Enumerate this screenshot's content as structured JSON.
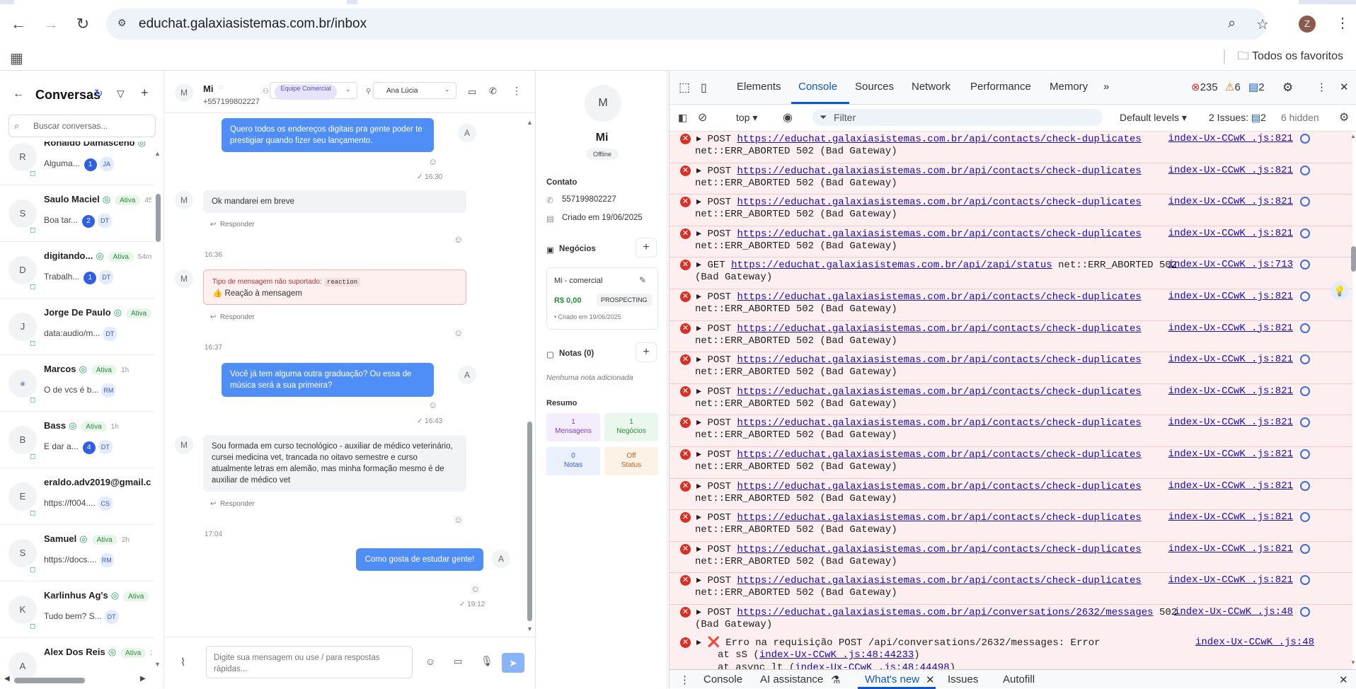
{
  "browser": {
    "url": "educhat.galaxiasistemas.com.br/inbox",
    "profile_initial": "Z",
    "bookmarks_label": "Todos os favoritos"
  },
  "sidebar": {
    "title": "Conversas",
    "search_placeholder": "Buscar conversas...",
    "conversations": [
      {
        "initial": "R",
        "name": "Ronaldo Damasceno",
        "status": "",
        "time": "",
        "preview": "Alguma...",
        "count": "1",
        "agent": "JA"
      },
      {
        "initial": "S",
        "name": "Saulo Maciel",
        "status": "Ativa",
        "time": "45",
        "preview": "Boa tar...",
        "count": "2",
        "agent": "DT"
      },
      {
        "initial": "D",
        "name": "digitando...",
        "status": "Ativa",
        "time": "54m",
        "preview": "Trabalh...",
        "count": "1",
        "agent": "DT"
      },
      {
        "initial": "J",
        "name": "Jorge De Paulo",
        "status": "Ativa",
        "time": "",
        "preview": "data:audio/m...",
        "count": "",
        "agent": "DT"
      },
      {
        "initial": "",
        "name": "Marcos",
        "status": "Ativa",
        "time": "1h",
        "preview": "O de vcs é b...",
        "count": "",
        "agent": "RM"
      },
      {
        "initial": "B",
        "name": "Bass",
        "status": "Ativa",
        "time": "1h",
        "preview": "E dar a...",
        "count": "4",
        "agent": "DT"
      },
      {
        "initial": "E",
        "name": "eraldo.adv2019@gmail.com",
        "status": "",
        "time": "",
        "preview": "https://f004....",
        "count": "",
        "agent": "CS"
      },
      {
        "initial": "S",
        "name": "Samuel",
        "status": "Ativa",
        "time": "2h",
        "preview": "https://docs....",
        "count": "",
        "agent": "RM"
      },
      {
        "initial": "K",
        "name": "Karlinhus Ag's",
        "status": "Ativa",
        "time": "2",
        "preview": "Tudo bem? S...",
        "count": "",
        "agent": "DT"
      },
      {
        "initial": "A",
        "name": "Alex Dos Reis",
        "status": "Ativa",
        "time": "2h",
        "preview": "",
        "count": "",
        "agent": ""
      }
    ]
  },
  "chat": {
    "contact_initial": "M",
    "contact_name": "Mi",
    "contact_phone": "+557199802227",
    "team": "Equipe Comercial",
    "agent": "Ana Lúcia",
    "messages": {
      "m1": "Quero todos os endereços digitais pra gente poder te prestigiar quando fizer seu lançamento.",
      "m1_time": "16:30",
      "m2": "Ok mandarei em breve",
      "reply": "Responder",
      "t1636": "16:36",
      "unsupported_label": "Tipo de mensagem não suportado:",
      "unsupported_type": "reaction",
      "reaction_text": "👍 Reação à mensagem",
      "t1637": "16:37",
      "m3": "Você já tem alguma outra graduação? Ou essa de música será a sua primeira?",
      "m3_time": "16:43",
      "m4": "Sou formada em curso tecnológico - auxiliar de médico veterinário, cursei medicina vet, trancada no oitavo semestre e curso atualmente letras em alemão, mas minha formação mesmo é de auxiliar de médico vet",
      "t1704": "17:04",
      "m5": "Como gosta de estudar gente!",
      "m5_time": "19:12",
      "out_avatar": "A"
    },
    "composer_placeholder": "Digite sua mensagem ou use / para respostas rápidas..."
  },
  "contact": {
    "initial": "M",
    "name": "Mi",
    "status": "Offline",
    "section_contact": "Contato",
    "phone": "557199802227",
    "created": "Criado em 19/06/2025",
    "deals_title": "Negócios",
    "deal_name": "Mi - comercial",
    "deal_value": "R$ 0,00",
    "deal_stage": "PROSPECTING",
    "deal_created": "• Criado em 19/06/2025",
    "notes_title": "Notas (0)",
    "notes_empty": "Nenhuma nota adicionada",
    "summary_title": "Resumo",
    "stats": [
      {
        "value": "1",
        "label": "Mensagens"
      },
      {
        "value": "1",
        "label": "Negócios"
      },
      {
        "value": "0",
        "label": "Notas"
      },
      {
        "value": "Off",
        "label": "Status"
      }
    ]
  },
  "devtools": {
    "tabs": [
      "Elements",
      "Console",
      "Sources",
      "Network",
      "Performance",
      "Memory"
    ],
    "errors": "235",
    "warnings": "6",
    "infos": "2",
    "context": "top",
    "filter_placeholder": "Filter",
    "levels": "Default levels",
    "issues": "2 Issues:",
    "issues_count": "2",
    "hidden": "6 hidden",
    "logs": [
      {
        "method": "POST",
        "url": "https://educhat.galaxiasistemas.com.br/api/contacts/check-duplicates",
        "tail": "",
        "line2": "net::ERR_ABORTED 502 (Bad Gateway)",
        "src": "index-Ux-CCwK_.js:821"
      },
      {
        "method": "POST",
        "url": "https://educhat.galaxiasistemas.com.br/api/contacts/check-duplicates",
        "tail": "",
        "line2": "net::ERR_ABORTED 502 (Bad Gateway)",
        "src": "index-Ux-CCwK_.js:821"
      },
      {
        "method": "POST",
        "url": "https://educhat.galaxiasistemas.com.br/api/contacts/check-duplicates",
        "tail": "",
        "line2": "net::ERR_ABORTED 502 (Bad Gateway)",
        "src": "index-Ux-CCwK_.js:821"
      },
      {
        "method": "POST",
        "url": "https://educhat.galaxiasistemas.com.br/api/contacts/check-duplicates",
        "tail": "",
        "line2": "net::ERR_ABORTED 502 (Bad Gateway)",
        "src": "index-Ux-CCwK_.js:821"
      },
      {
        "method": "GET",
        "url": "https://educhat.galaxiasistemas.com.br/api/zapi/status",
        "tail": " net::ERR_ABORTED 502",
        "line2": "(Bad Gateway)",
        "src": "index-Ux-CCwK_.js:713"
      },
      {
        "method": "POST",
        "url": "https://educhat.galaxiasistemas.com.br/api/contacts/check-duplicates",
        "tail": "",
        "line2": "net::ERR_ABORTED 502 (Bad Gateway)",
        "src": "index-Ux-CCwK_.js:821"
      },
      {
        "method": "POST",
        "url": "https://educhat.galaxiasistemas.com.br/api/contacts/check-duplicates",
        "tail": "",
        "line2": "net::ERR_ABORTED 502 (Bad Gateway)",
        "src": "index-Ux-CCwK_.js:821"
      },
      {
        "method": "POST",
        "url": "https://educhat.galaxiasistemas.com.br/api/contacts/check-duplicates",
        "tail": "",
        "line2": "net::ERR_ABORTED 502 (Bad Gateway)",
        "src": "index-Ux-CCwK_.js:821"
      },
      {
        "method": "POST",
        "url": "https://educhat.galaxiasistemas.com.br/api/contacts/check-duplicates",
        "tail": "",
        "line2": "net::ERR_ABORTED 502 (Bad Gateway)",
        "src": "index-Ux-CCwK_.js:821"
      },
      {
        "method": "POST",
        "url": "https://educhat.galaxiasistemas.com.br/api/contacts/check-duplicates",
        "tail": "",
        "line2": "net::ERR_ABORTED 502 (Bad Gateway)",
        "src": "index-Ux-CCwK_.js:821"
      },
      {
        "method": "POST",
        "url": "https://educhat.galaxiasistemas.com.br/api/contacts/check-duplicates",
        "tail": "",
        "line2": "net::ERR_ABORTED 502 (Bad Gateway)",
        "src": "index-Ux-CCwK_.js:821"
      },
      {
        "method": "POST",
        "url": "https://educhat.galaxiasistemas.com.br/api/contacts/check-duplicates",
        "tail": "",
        "line2": "net::ERR_ABORTED 502 (Bad Gateway)",
        "src": "index-Ux-CCwK_.js:821"
      },
      {
        "method": "POST",
        "url": "https://educhat.galaxiasistemas.com.br/api/contacts/check-duplicates",
        "tail": "",
        "line2": "net::ERR_ABORTED 502 (Bad Gateway)",
        "src": "index-Ux-CCwK_.js:821"
      },
      {
        "method": "POST",
        "url": "https://educhat.galaxiasistemas.com.br/api/contacts/check-duplicates",
        "tail": "",
        "line2": "net::ERR_ABORTED 502 (Bad Gateway)",
        "src": "index-Ux-CCwK_.js:821"
      },
      {
        "method": "POST",
        "url": "https://educhat.galaxiasistemas.com.br/api/contacts/check-duplicates",
        "tail": "",
        "line2": "net::ERR_ABORTED 502 (Bad Gateway)",
        "src": "index-Ux-CCwK_.js:821"
      },
      {
        "method": "POST",
        "url": "https://educhat.galaxiasistemas.com.br/api/conversations/2632/messages",
        "tail": " 502",
        "line2": "(Bad Gateway)",
        "src": "index-Ux-CCwK_.js:48"
      }
    ],
    "final_log": {
      "text": "❌ Erro na requisição POST /api/conversations/2632/messages: Error",
      "src": "index-Ux-CCwK_.js:48",
      "stack1_pre": "at sS (",
      "stack1_link": "index-Ux-CCwK_.js:48:44233",
      "stack1_post": ")",
      "stack2_pre": "at async lt (",
      "stack2_link": "index-Ux-CCwK_.js:48:44498",
      "stack2_post": ")"
    },
    "drawer_tabs": [
      "Console",
      "AI assistance",
      "What's new",
      "Issues",
      "Autofill"
    ]
  }
}
